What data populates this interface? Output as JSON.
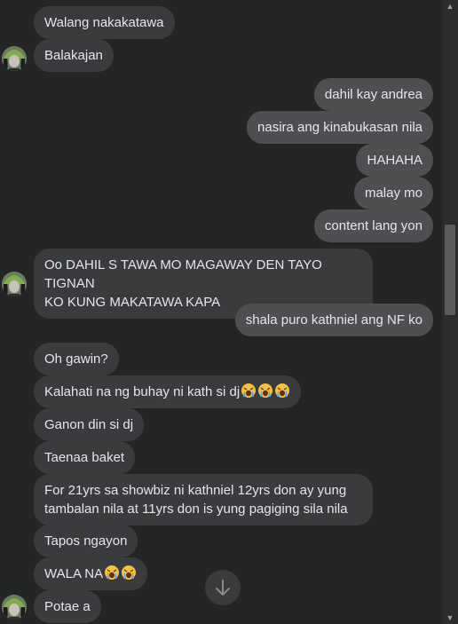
{
  "messages": [
    {
      "text": "Walang nakakatawa",
      "dir": "in"
    },
    {
      "text": "Balakajan",
      "dir": "in"
    },
    {
      "text": "dahil kay andrea",
      "dir": "out"
    },
    {
      "text": "nasira ang kinabukasan nila",
      "dir": "out"
    },
    {
      "text": "HAHAHA",
      "dir": "out"
    },
    {
      "text": "malay mo",
      "dir": "out"
    },
    {
      "text": "content lang yon",
      "dir": "out"
    },
    {
      "line1": "Oo DAHIL S TAWA MO MAGAWAY DEN TAYO TIGNAN",
      "line2": "KO KUNG MAKATAWA KAPA",
      "dir": "in"
    },
    {
      "text": "shala puro kathniel ang NF ko",
      "dir": "out"
    },
    {
      "text": "Oh gawin?",
      "dir": "in"
    },
    {
      "text": "Kalahati na ng buhay ni kath si dj",
      "dir": "in",
      "emoji": "crying-face x3"
    },
    {
      "text": "Ganon din si dj",
      "dir": "in"
    },
    {
      "text": "Taenaa baket",
      "dir": "in"
    },
    {
      "line1": "For 21yrs sa showbiz ni kathniel 12yrs don ay yung",
      "line2": "tambalan nila at 11yrs don is yung pagiging sila nila",
      "dir": "in"
    },
    {
      "text": "Tapos ngayon",
      "dir": "in"
    },
    {
      "text": "WALA NA",
      "dir": "in",
      "emoji": "crying-face x2"
    },
    {
      "text": "Potae a",
      "dir": "in"
    }
  ],
  "icons": {
    "scroll_down": "arrow-down-icon",
    "emoji": "loudly-crying-face"
  },
  "colors": {
    "background": "#242526",
    "incoming_bubble": "#3a3b3c",
    "outgoing_bubble": "#4e4f50",
    "text": "#e4e6eb"
  }
}
